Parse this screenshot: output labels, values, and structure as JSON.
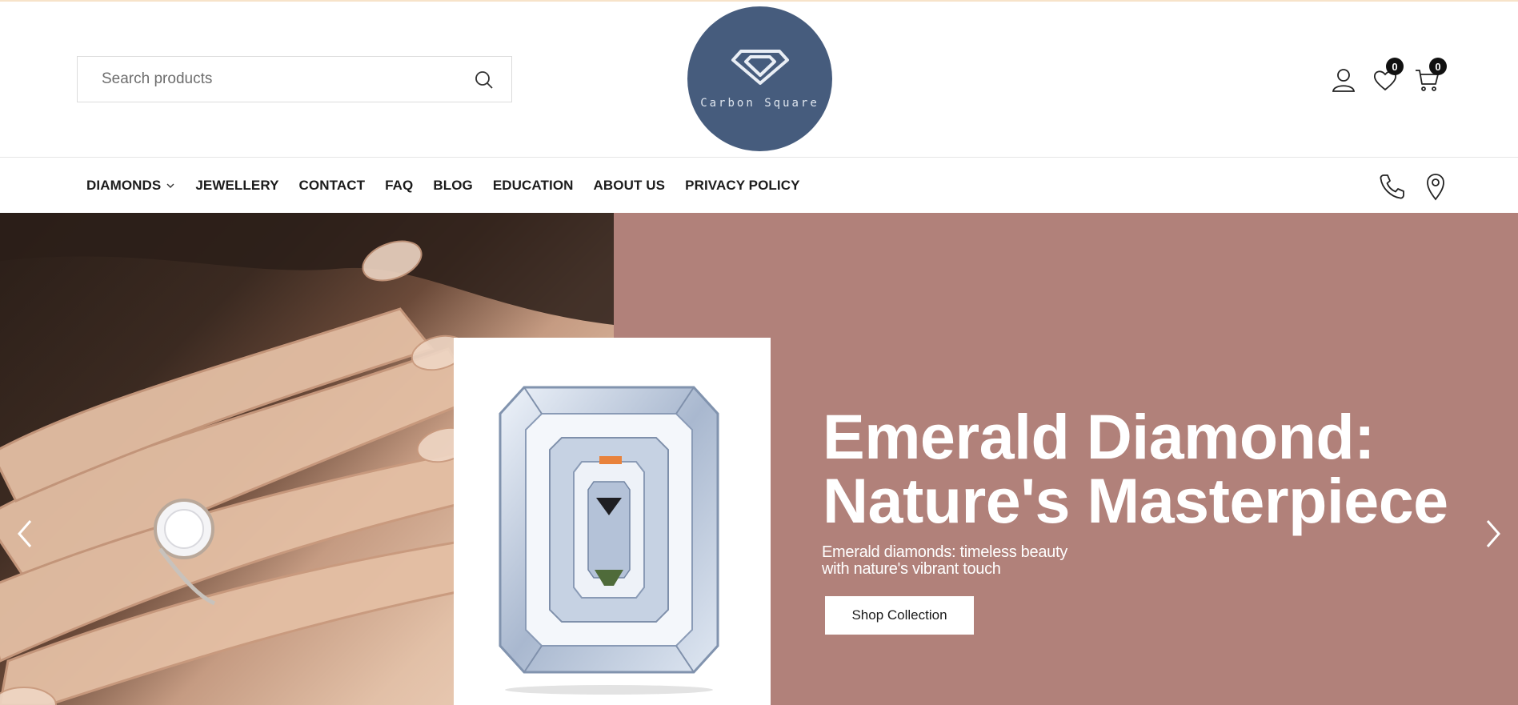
{
  "search": {
    "placeholder": "Search products"
  },
  "brand": {
    "name": "Carbon Square"
  },
  "header": {
    "wishlist_count": "0",
    "cart_count": "0"
  },
  "nav": {
    "items": [
      {
        "label": "DIAMONDS"
      },
      {
        "label": "JEWELLERY"
      },
      {
        "label": "CONTACT"
      },
      {
        "label": "FAQ"
      },
      {
        "label": "BLOG"
      },
      {
        "label": "EDUCATION"
      },
      {
        "label": "ABOUT US"
      },
      {
        "label": "PRIVACY POLICY"
      }
    ]
  },
  "hero": {
    "title_line1": "Emerald Diamond:",
    "title_line2": "Nature's Masterpiece",
    "subtitle_line1": "Emerald diamonds: timeless beauty",
    "subtitle_line2": "with nature's vibrant touch",
    "cta": "Shop Collection"
  },
  "colors": {
    "logo_bg": "#465c7d",
    "hero_bg": "#b1817a",
    "badge_bg": "#111111"
  }
}
